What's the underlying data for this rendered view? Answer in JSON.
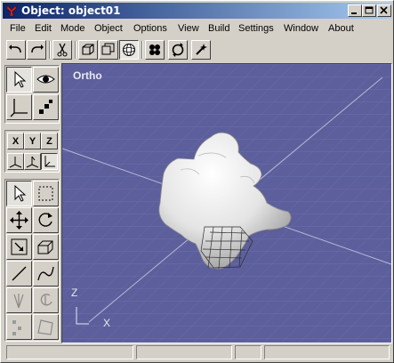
{
  "window": {
    "title": "Object: object01"
  },
  "menu": [
    "File",
    "Edit",
    "Mode",
    "Object",
    "Options",
    "View",
    "Build",
    "Settings",
    "Window",
    "About"
  ],
  "toolbar": {
    "buttons": [
      "undo-icon",
      "redo-icon",
      "cut-icon",
      "box-icon",
      "copy-object-icon",
      "sphere-icon",
      "subdivide-icon",
      "rotate-view-icon",
      "sparkle-icon"
    ]
  },
  "tools": {
    "axes": [
      "X",
      "Y",
      "Z"
    ]
  },
  "viewport": {
    "label": "Ortho",
    "axis_z": "Z",
    "axis_x": "X",
    "background": "#5c5f9b"
  },
  "status": [
    "",
    "",
    "",
    ""
  ]
}
